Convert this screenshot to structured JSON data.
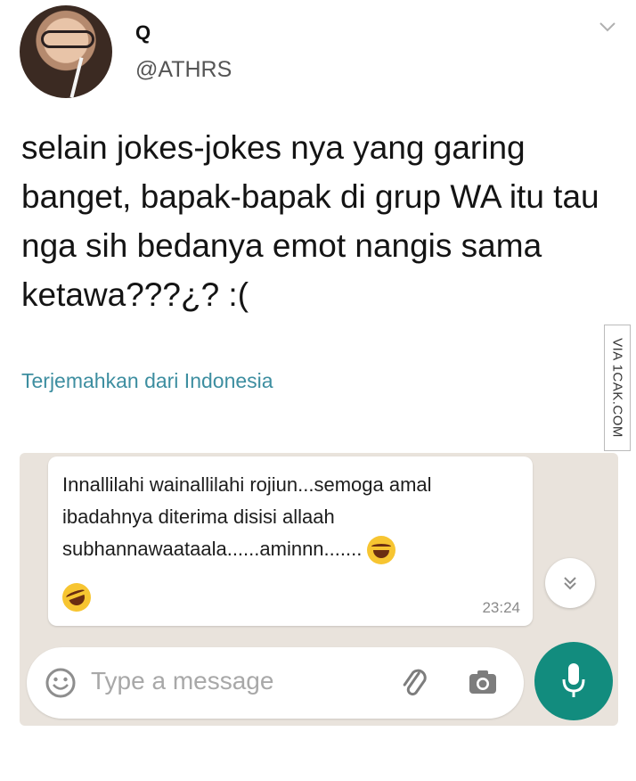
{
  "tweet": {
    "display_name": "Q",
    "handle": "@ATHRS",
    "text": "selain jokes-jokes nya yang garing banget, bapak-bapak di grup WA itu tau nga sih bedanya emot nangis sama ketawa???¿? :(",
    "translate_label": "Terjemahkan dari Indonesia",
    "menu_icon": "chevron-down-icon"
  },
  "watermark": "VIA 1CAK.COM",
  "chat": {
    "message": {
      "text": "Innallilahi wainallilahi rojiun...semoga amal ibadahnya diterima disisi allaah subhannawaataala......aminnn.......",
      "emoji": "laughing-tears-emoji",
      "time": "23:24"
    },
    "scroll_icon": "double-chevron-down-icon",
    "input": {
      "placeholder": "Type a message",
      "emoji_icon": "smiley-icon",
      "attach_icon": "paperclip-icon",
      "camera_icon": "camera-icon"
    },
    "mic_icon": "microphone-icon",
    "colors": {
      "mic_button": "#128c7e",
      "chat_background": "#e9e3dc",
      "translate_link": "#3d8ea0"
    }
  }
}
